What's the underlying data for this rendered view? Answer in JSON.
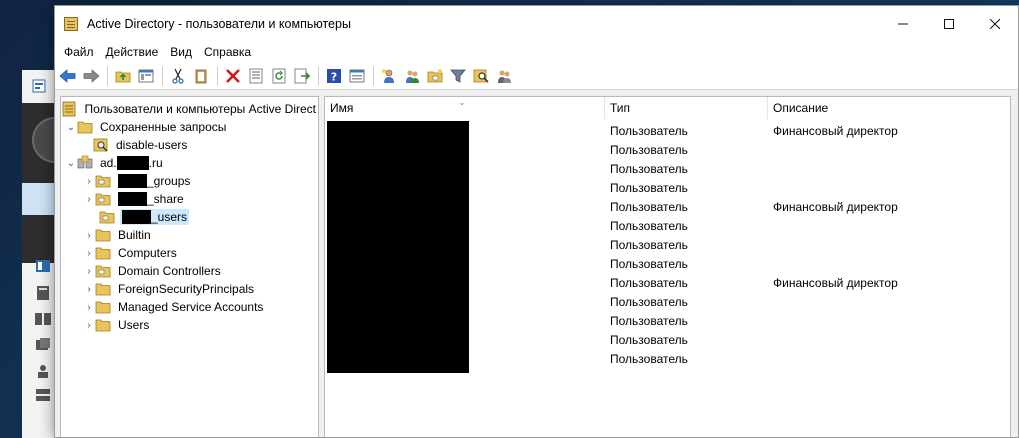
{
  "window": {
    "title": "Active Directory - пользователи и компьютеры",
    "controls": [
      "minimize-icon",
      "maximize-icon",
      "close-icon"
    ]
  },
  "menu": [
    "Файл",
    "Действие",
    "Вид",
    "Справка"
  ],
  "toolbar": {
    "icons": [
      "back-arrow-icon",
      "forward-arrow-icon",
      "up-folder-icon",
      "show-tree-icon",
      "cut-icon",
      "copy-icon",
      "delete-icon",
      "properties-icon",
      "refresh-icon",
      "export-list-icon",
      "help-icon",
      "console-view-icon",
      "new-user-icon",
      "new-group-icon",
      "new-ou-icon",
      "filter-icon",
      "find-icon",
      "add-to-group-icon"
    ]
  },
  "tree": {
    "root": "Пользователи и компьютеры Active Direct",
    "saved_queries": "Сохраненные запросы",
    "disable_users": "disable-users",
    "domain_prefix": "ad.",
    "domain_suffix": ".ru",
    "ou_groups_suffix": "_groups",
    "ou_share_suffix": "_share",
    "ou_users_suffix": "_users",
    "builtin": "Builtin",
    "computers": "Computers",
    "domain_controllers": "Domain Controllers",
    "foreign": "ForeignSecurityPrincipals",
    "managed": "Managed Service Accounts",
    "users": "Users"
  },
  "list": {
    "columns": {
      "name": "Имя",
      "type": "Тип",
      "description": "Описание"
    },
    "rows": [
      {
        "type": "Пользователь",
        "description": "Финансовый директор"
      },
      {
        "type": "Пользователь",
        "description": ""
      },
      {
        "type": "Пользователь",
        "description": ""
      },
      {
        "type": "Пользователь",
        "description": ""
      },
      {
        "type": "Пользователь",
        "description": "Финансовый директор"
      },
      {
        "type": "Пользователь",
        "description": ""
      },
      {
        "type": "Пользователь",
        "description": ""
      },
      {
        "type": "Пользователь",
        "description": ""
      },
      {
        "type": "Пользователь",
        "description": "Финансовый директор"
      },
      {
        "type": "Пользователь",
        "description": ""
      },
      {
        "type": "Пользователь",
        "description": ""
      },
      {
        "type": "Пользователь",
        "description": ""
      },
      {
        "type": "Пользователь",
        "description": ""
      }
    ]
  },
  "colors": {
    "selection": "#cce8ff",
    "redaction": "#000000",
    "folder": "#e8c45a"
  }
}
